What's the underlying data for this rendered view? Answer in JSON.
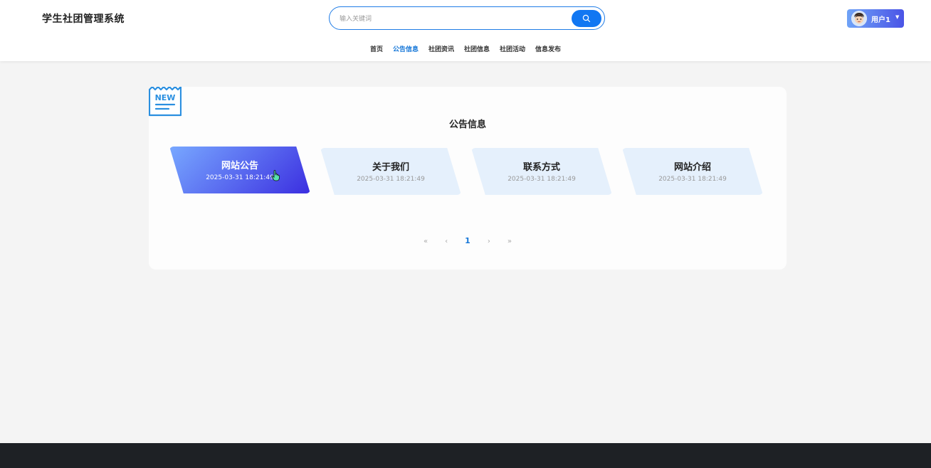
{
  "app": {
    "title": "学生社团管理系统"
  },
  "search": {
    "placeholder": "输入关键词",
    "value": "",
    "button_icon": "search-icon"
  },
  "user": {
    "label": "用户1",
    "avatar_icon": "avatar-icon",
    "caret_icon": "caret-down-icon"
  },
  "nav": {
    "items": [
      {
        "label": "首页",
        "active": false
      },
      {
        "label": "公告信息",
        "active": true
      },
      {
        "label": "社团资讯",
        "active": false
      },
      {
        "label": "社团信息",
        "active": false
      },
      {
        "label": "社团活动",
        "active": false
      },
      {
        "label": "信息发布",
        "active": false
      }
    ]
  },
  "section": {
    "badge_text": "NEW",
    "title": "公告信息"
  },
  "notices": [
    {
      "title": "网站公告",
      "date": "2025-03-31 18:21:49",
      "active": true
    },
    {
      "title": "关于我们",
      "date": "2025-03-31 18:21:49",
      "active": false
    },
    {
      "title": "联系方式",
      "date": "2025-03-31 18:21:49",
      "active": false
    },
    {
      "title": "网站介绍",
      "date": "2025-03-31 18:21:49",
      "active": false
    }
  ],
  "pagination": {
    "first": "«",
    "prev": "‹",
    "current": "1",
    "next": "›",
    "last": "»"
  },
  "colors": {
    "accent": "#1677d8",
    "active_gradient_start": "#78a8ff",
    "active_gradient_end": "#3b2ee0",
    "card_bg": "#e5f0fc",
    "footer_bg": "#1e2125"
  }
}
